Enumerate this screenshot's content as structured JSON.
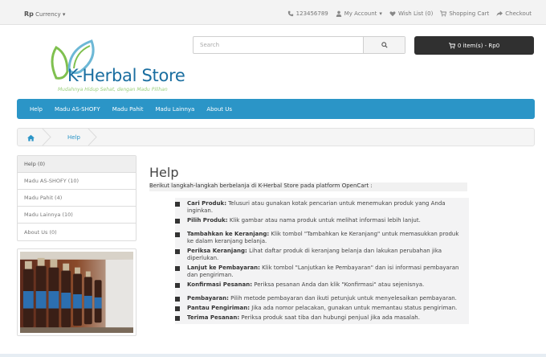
{
  "topbar": {
    "currency_symbol": "Rp",
    "currency_label": "Currency",
    "phone": "123456789",
    "my_account": "My Account",
    "wish_list": "Wish List (0)",
    "shopping_cart": "Shopping Cart",
    "checkout": "Checkout"
  },
  "header": {
    "logo_title": "K-Herbal Store",
    "logo_tagline": "Mudahnya Hidup Sehat, dengan Madu Pilihan",
    "search_placeholder": "Search",
    "cart_label": "0 item(s) - Rp0"
  },
  "nav": {
    "items": [
      "Help",
      "Madu AS-SHOFY",
      "Madu Pahit",
      "Madu Lainnya",
      "About Us"
    ]
  },
  "breadcrumb": {
    "current": "Help"
  },
  "sidebar": {
    "items": [
      "Help (0)",
      "Madu AS-SHOFY (10)",
      "Madu Pahit (4)",
      "Madu Lainnya (10)",
      "About Us (0)"
    ]
  },
  "content": {
    "title": "Help",
    "intro": "Berikut langkah-langkah berbelanja di K-Herbal Store pada platform OpenCart :",
    "steps": [
      {
        "term": "Cari Produk:",
        "text": " Telusuri atau gunakan kotak pencarian untuk menemukan produk yang Anda inginkan."
      },
      {
        "term": "Pilih Produk:",
        "text": " Klik gambar atau nama produk untuk melihat informasi lebih lanjut."
      },
      {
        "term": "Tambahkan ke Keranjang:",
        "text": " Klik tombol \"Tambahkan ke Keranjang\" untuk memasukkan produk ke dalam keranjang belanja."
      },
      {
        "term": "Periksa Keranjang:",
        "text": " Lihat daftar produk di keranjang belanja dan lakukan perubahan jika diperlukan."
      },
      {
        "term": "Lanjut ke Pembayaran:",
        "text": " Klik tombol \"Lanjutkan ke Pembayaran\" dan isi informasi pembayaran dan pengiriman."
      },
      {
        "term": "Konfirmasi Pesanan:",
        "text": " Periksa pesanan Anda dan klik \"Konfirmasi\" atau sejenisnya."
      },
      {
        "term": "Pembayaran:",
        "text": " Pilih metode pembayaran dan ikuti petunjuk untuk menyelesaikan pembayaran."
      },
      {
        "term": "Pantau Pengiriman:",
        "text": " Jika ada nomor pelacakan, gunakan untuk memantau status pengiriman."
      },
      {
        "term": "Terima Pesanan:",
        "text": " Periksa produk saat tiba dan hubungi penjual jika ada masalah."
      }
    ]
  },
  "colors": {
    "nav_bg": "#2b95c7",
    "cart_bg": "#303030",
    "logo_blue": "#1a6ea0",
    "logo_green": "#7fc04f"
  }
}
